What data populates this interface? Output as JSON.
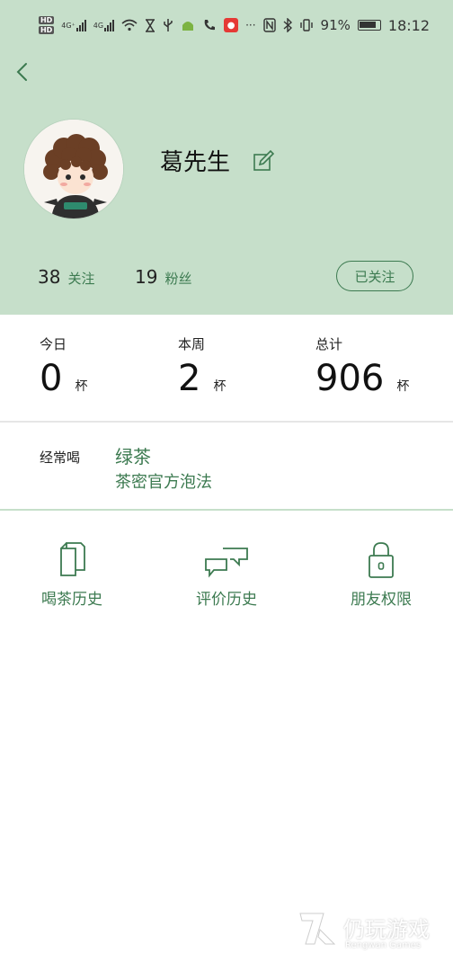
{
  "status_bar": {
    "network_1": "4G⁺",
    "network_2": "4G",
    "battery": "91%",
    "time": "18:12",
    "icons": [
      "hd-icon",
      "signal-icon",
      "wifi-icon",
      "hourglass-icon",
      "usb-icon",
      "android-icon",
      "call-icon",
      "mic-icon",
      "more-icon",
      "nfc-icon",
      "bluetooth-icon",
      "vibrate-icon",
      "battery-icon"
    ]
  },
  "profile": {
    "back_icon": "chevron-left-icon",
    "name": "葛先生",
    "edit_icon": "edit-icon",
    "follow_count": "38",
    "follow_label": "关注",
    "fans_count": "19",
    "fans_label": "粉丝",
    "followed_button": "已关注"
  },
  "cups": {
    "today": {
      "label": "今日",
      "value": "0",
      "unit": "杯"
    },
    "week": {
      "label": "本周",
      "value": "2",
      "unit": "杯"
    },
    "total": {
      "label": "总计",
      "value": "906",
      "unit": "杯"
    }
  },
  "often": {
    "label": "经常喝",
    "tea": "绿茶",
    "method": "茶密官方泡法"
  },
  "actions": [
    {
      "label": "喝茶历史",
      "icon": "documents-icon"
    },
    {
      "label": "评价历史",
      "icon": "chat-bubbles-icon"
    },
    {
      "label": "朋友权限",
      "icon": "lock-icon"
    }
  ],
  "colors": {
    "header_bg": "#c6dfca",
    "accent": "#3c7a50"
  },
  "watermark": {
    "title": "仍玩游戏",
    "subtitle": "Rengwan Games"
  }
}
